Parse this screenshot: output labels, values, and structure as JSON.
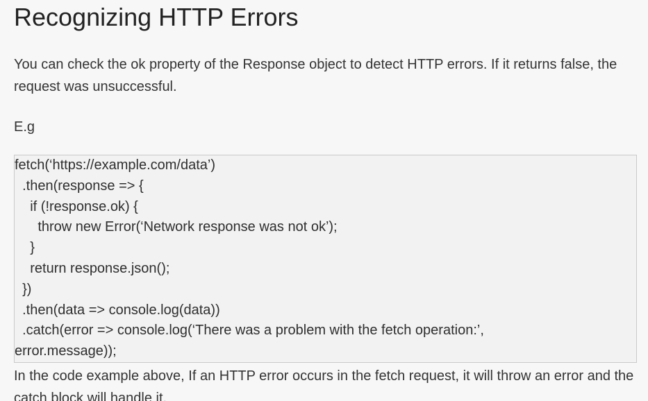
{
  "heading": "Recognizing HTTP Errors",
  "intro": "You can check the ok property of the Response object to detect HTTP errors. If it returns false, the request was unsuccessful.",
  "example_label": "E.g",
  "code_lines": [
    "fetch(‘https://example.com/data’)",
    "  .then(response => {",
    "    if (!response.ok) {",
    "      throw new Error(‘Network response was not ok’);",
    "    }",
    "    return response.json();",
    "  })",
    "  .then(data => console.log(data))",
    "  .catch(error => console.log(‘There was a problem with the fetch operation:’,",
    "error.message));"
  ],
  "outro": "In the code example above, If an HTTP error occurs in the fetch request, it will throw an error and the catch block will handle it."
}
